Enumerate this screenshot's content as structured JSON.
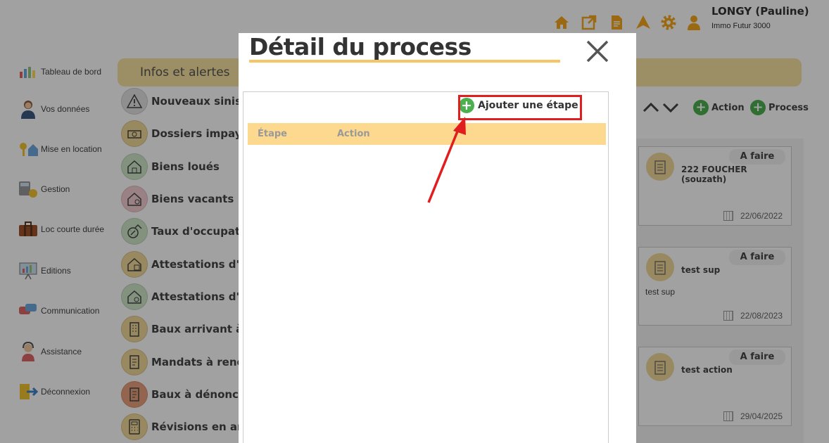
{
  "header": {
    "user_name": "LONGY (Pauline)",
    "company": "Immo Futur 3000",
    "icons": [
      "home-icon",
      "external-link-icon",
      "document-icon",
      "paper-plane-icon",
      "gear-icon",
      "user-icon"
    ],
    "icon_color": "#f4a71d"
  },
  "sidebar": {
    "items": [
      {
        "label": "Tableau de bord",
        "icon": "dashboard-icon"
      },
      {
        "label": "Vos données",
        "icon": "person-icon"
      },
      {
        "label": "Mise en location",
        "icon": "key-house-icon"
      },
      {
        "label": "Gestion",
        "icon": "calculator-icon"
      },
      {
        "label": "Loc courte durée",
        "icon": "suitcase-icon"
      },
      {
        "label": "Editions",
        "icon": "chart-board-icon"
      },
      {
        "label": "Communication",
        "icon": "chat-bubbles-icon"
      },
      {
        "label": "Assistance",
        "icon": "headset-icon"
      },
      {
        "label": "Déconnexion",
        "icon": "logout-icon"
      }
    ]
  },
  "tabbar": {
    "active_tab": "Infos et alertes"
  },
  "alerts": [
    {
      "label": "Nouveaux sinistr",
      "icon": "warning-icon",
      "color": "#e3e3e3"
    },
    {
      "label": "Dossiers impayé",
      "icon": "money-icon",
      "color": "#f3d99a"
    },
    {
      "label": "Biens loués",
      "icon": "rented-house-icon",
      "color": "#cfe8c9"
    },
    {
      "label": "Biens vacants",
      "icon": "vacant-house-icon",
      "color": "#f2cdd2"
    },
    {
      "label": "Taux d'occupatio",
      "icon": "occupancy-icon",
      "color": "#cfe8c9"
    },
    {
      "label": "Attestations d'as",
      "icon": "insurance-house-icon",
      "color": "#f3d99a"
    },
    {
      "label": "Attestations d'en",
      "icon": "certificate-house-icon",
      "color": "#cfe8c9"
    },
    {
      "label": "Baux arrivant à é",
      "icon": "building-icon",
      "color": "#f3d99a"
    },
    {
      "label": "Mandats à renou",
      "icon": "mandate-doc-icon",
      "color": "#f3d99a"
    },
    {
      "label": "Baux à dénoncer",
      "icon": "lease-doc-icon",
      "color": "#e9a17c"
    },
    {
      "label": "Révisions en anc",
      "icon": "calculator-icon",
      "color": "#f3d99a"
    }
  ],
  "toolbar": {
    "action_label": "Action",
    "process_label": "Process"
  },
  "cards": [
    {
      "status": "A faire",
      "title": "222 FOUCHER (souzath)",
      "description": "",
      "date": "22/06/2022"
    },
    {
      "status": "A faire",
      "title": "test sup",
      "description": "test sup",
      "date": "22/08/2023"
    },
    {
      "status": "A faire",
      "title": "test action",
      "description": "",
      "date": "29/04/2025"
    }
  ],
  "modal": {
    "title": "Détail du process",
    "add_step_label": "Ajouter une étape",
    "columns": [
      "Étape",
      "Action"
    ],
    "accent_color": "#f5c663",
    "header_color": "#fcd98f",
    "highlight_color": "#e01e1e"
  }
}
